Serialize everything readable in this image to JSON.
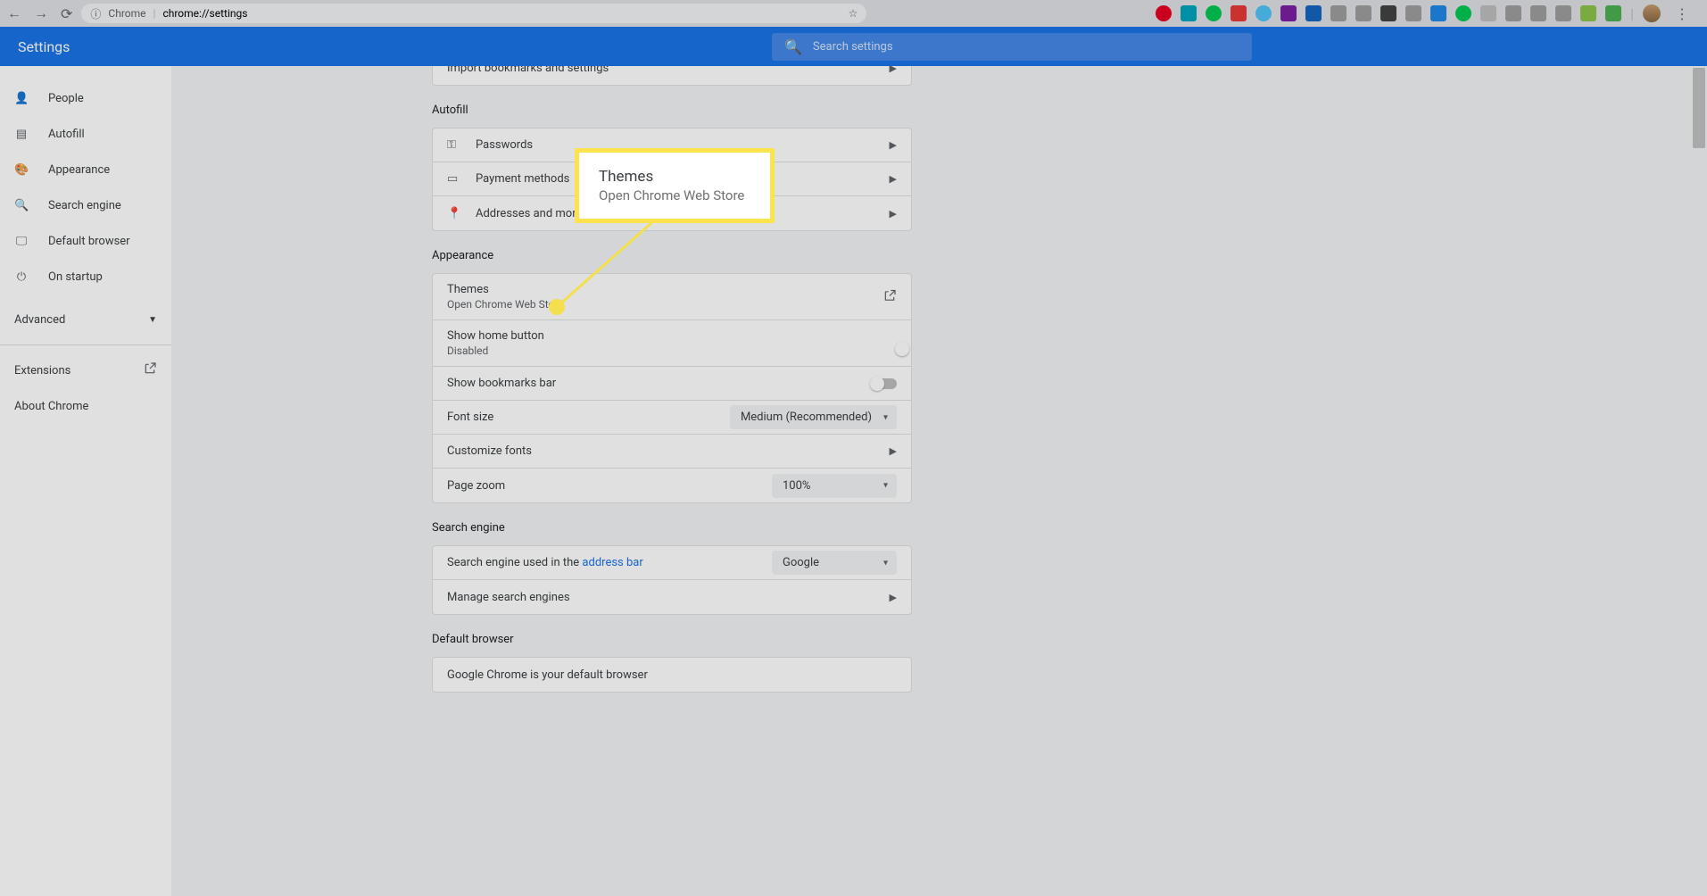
{
  "url": {
    "host": "Chrome",
    "path": "chrome://settings"
  },
  "app_title": "Settings",
  "search_placeholder": "Search settings",
  "sidebar": {
    "items": [
      {
        "icon": "👤",
        "label": "People"
      },
      {
        "icon": "▤",
        "label": "Autofill"
      },
      {
        "icon": "🎨",
        "label": "Appearance"
      },
      {
        "icon": "🔍",
        "label": "Search engine"
      },
      {
        "icon": "🖵",
        "label": "Default browser"
      },
      {
        "icon": "⏻",
        "label": "On startup"
      }
    ],
    "advanced": "Advanced",
    "extensions": "Extensions",
    "about": "About Chrome"
  },
  "sections": {
    "import": {
      "label": "Import bookmarks and settings"
    },
    "autofill": {
      "title": "Autofill",
      "rows": [
        {
          "icon": "⚿",
          "label": "Passwords"
        },
        {
          "icon": "▭",
          "label": "Payment methods"
        },
        {
          "icon": "📍",
          "label": "Addresses and more"
        }
      ]
    },
    "appearance": {
      "title": "Appearance",
      "themes": {
        "t1": "Themes",
        "t2": "Open Chrome Web Store"
      },
      "home": {
        "t1": "Show home button",
        "t2": "Disabled"
      },
      "bookmarks": "Show bookmarks bar",
      "font_size_label": "Font size",
      "font_size_value": "Medium (Recommended)",
      "customize_fonts": "Customize fonts",
      "page_zoom_label": "Page zoom",
      "page_zoom_value": "100%"
    },
    "search": {
      "title": "Search engine",
      "engine_prefix": "Search engine used in the ",
      "engine_link": "address bar",
      "engine_value": "Google",
      "manage": "Manage search engines"
    },
    "default": {
      "title": "Default browser",
      "text": "Google Chrome is your default browser"
    }
  },
  "callout": {
    "c1": "Themes",
    "c2": "Open Chrome Web Store"
  }
}
